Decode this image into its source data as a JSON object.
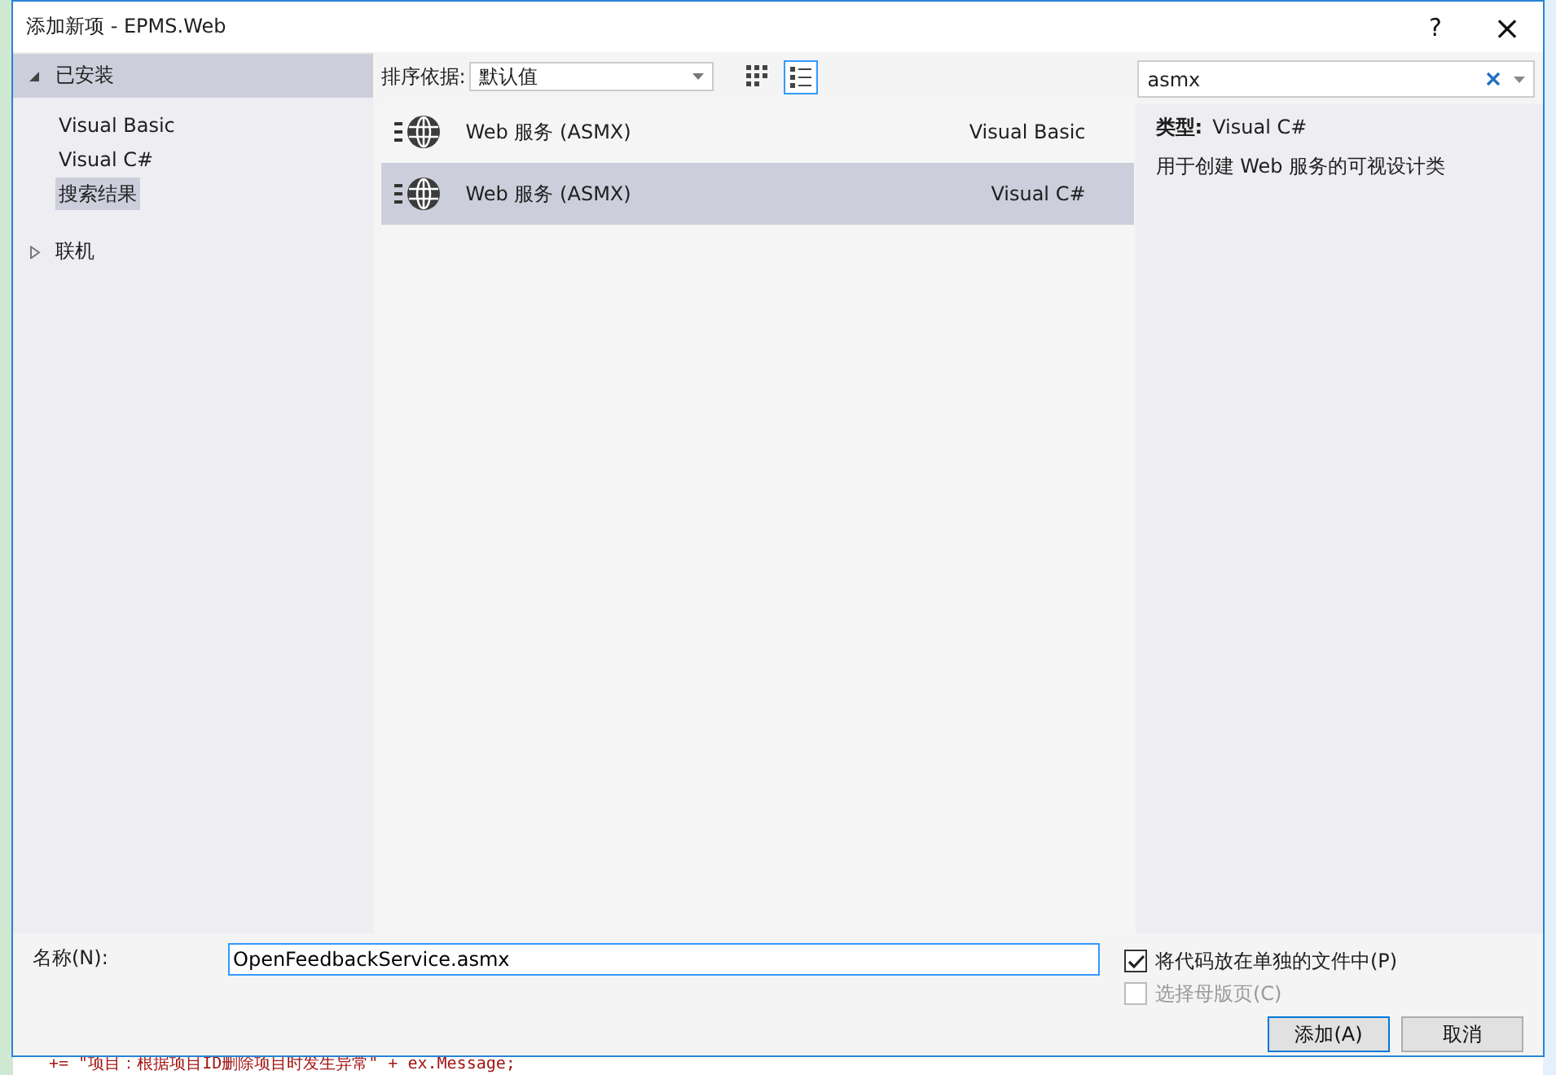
{
  "window": {
    "title": "添加新项 - EPMS.Web",
    "help": "?",
    "close": "×"
  },
  "tree": [
    {
      "label": "已安装",
      "expanded": true,
      "selected": true,
      "children": [
        {
          "label": "Visual Basic",
          "selected": false
        },
        {
          "label": "Visual C#",
          "selected": false
        },
        {
          "label": "搜索结果",
          "selected": true
        }
      ]
    },
    {
      "label": "联机",
      "expanded": false,
      "selected": false
    }
  ],
  "sort": {
    "label": "排序依据:",
    "value": "默认值"
  },
  "view_buttons": [
    {
      "kind": "grid",
      "selected": false
    },
    {
      "kind": "list",
      "selected": true
    }
  ],
  "templates": [
    {
      "name": "Web 服务 (ASMX)",
      "language": "Visual Basic",
      "selected": false
    },
    {
      "name": "Web 服务 (ASMX)",
      "language": "Visual C#",
      "selected": true
    }
  ],
  "search": {
    "value": "asmx"
  },
  "details": {
    "type_label": "类型:",
    "type_value": "Visual C#",
    "description": "用于创建 Web 服务的可视设计类"
  },
  "name_field": {
    "label": "名称(N):",
    "value": "OpenFeedbackService.asmx"
  },
  "options": [
    {
      "label": "将代码放在单独的文件中(P)",
      "checked": true,
      "disabled": false
    },
    {
      "label": "选择母版页(C)",
      "checked": false,
      "disabled": true
    }
  ],
  "buttons": [
    {
      "label": "添加(A)",
      "default": true
    },
    {
      "label": "取消",
      "default": false
    }
  ],
  "background_code": "+= \"项目：根据项目ID删除项目时发生异常\" + ex.Message;"
}
